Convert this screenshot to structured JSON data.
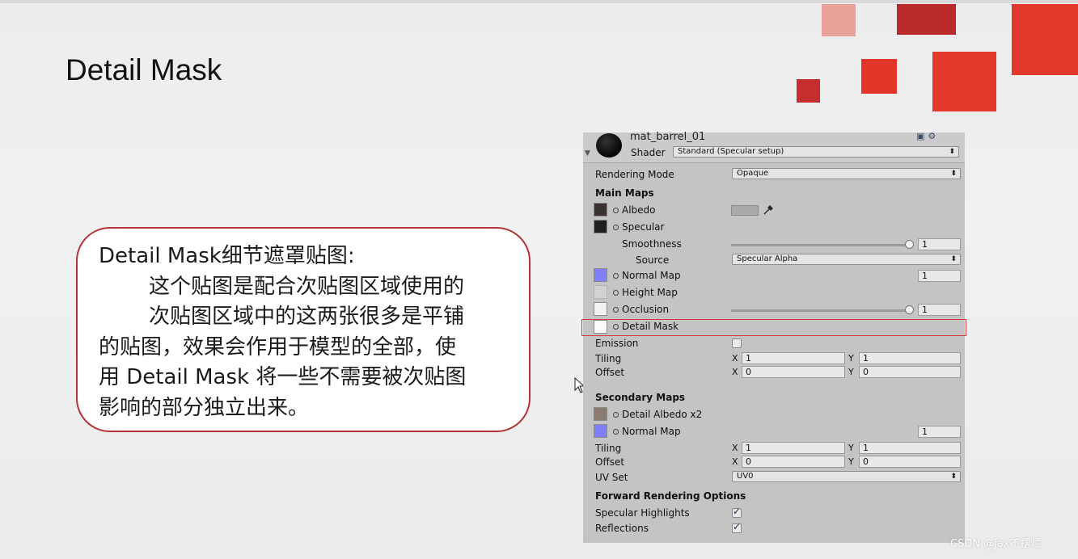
{
  "slide": {
    "title": "Detail Mask",
    "accent_color": "#d63b2f"
  },
  "callout": {
    "heading": "Detail Mask细节遮罩贴图:",
    "lines": [
      "这个贴图是配合次贴图区域使用的",
      "次贴图区域中的这两张很多是平铺",
      "的贴图，效果会作用于模型的全部，使",
      "用 Detail Mask 将一些不需要被次贴图",
      "影响的部分独立出来。"
    ],
    "border_color": "#b6333a"
  },
  "inspector": {
    "material_name": "mat_barrel_01",
    "shader_label": "Shader",
    "shader_value": "Standard (Specular setup)",
    "rendering_mode_label": "Rendering Mode",
    "rendering_mode_value": "Opaque",
    "main_maps": {
      "heading": "Main Maps",
      "albedo": "Albedo",
      "specular": "Specular",
      "smoothness": "Smoothness",
      "smoothness_value": "1",
      "source": "Source",
      "source_value": "Specular Alpha",
      "normal_map": "Normal Map",
      "normal_map_value": "1",
      "height_map": "Height Map",
      "occlusion": "Occlusion",
      "occlusion_value": "1",
      "detail_mask": "Detail Mask",
      "emission": "Emission",
      "tiling": "Tiling",
      "offset": "Offset",
      "tiling_x": "1",
      "tiling_y": "1",
      "offset_x": "0",
      "offset_y": "0"
    },
    "secondary_maps": {
      "heading": "Secondary Maps",
      "detail_albedo": "Detail Albedo x2",
      "normal_map": "Normal Map",
      "normal_map_value": "1",
      "tiling": "Tiling",
      "offset": "Offset",
      "tiling_x": "1",
      "tiling_y": "1",
      "offset_x": "0",
      "offset_y": "0",
      "uv_set_label": "UV Set",
      "uv_set_value": "UV0"
    },
    "forward_options": {
      "heading": "Forward Rendering Options",
      "specular_highlights": "Specular Highlights",
      "reflections": "Reflections"
    },
    "axis_x": "X",
    "axis_y": "Y"
  },
  "watermark": "CSDN @jax不摆烂"
}
